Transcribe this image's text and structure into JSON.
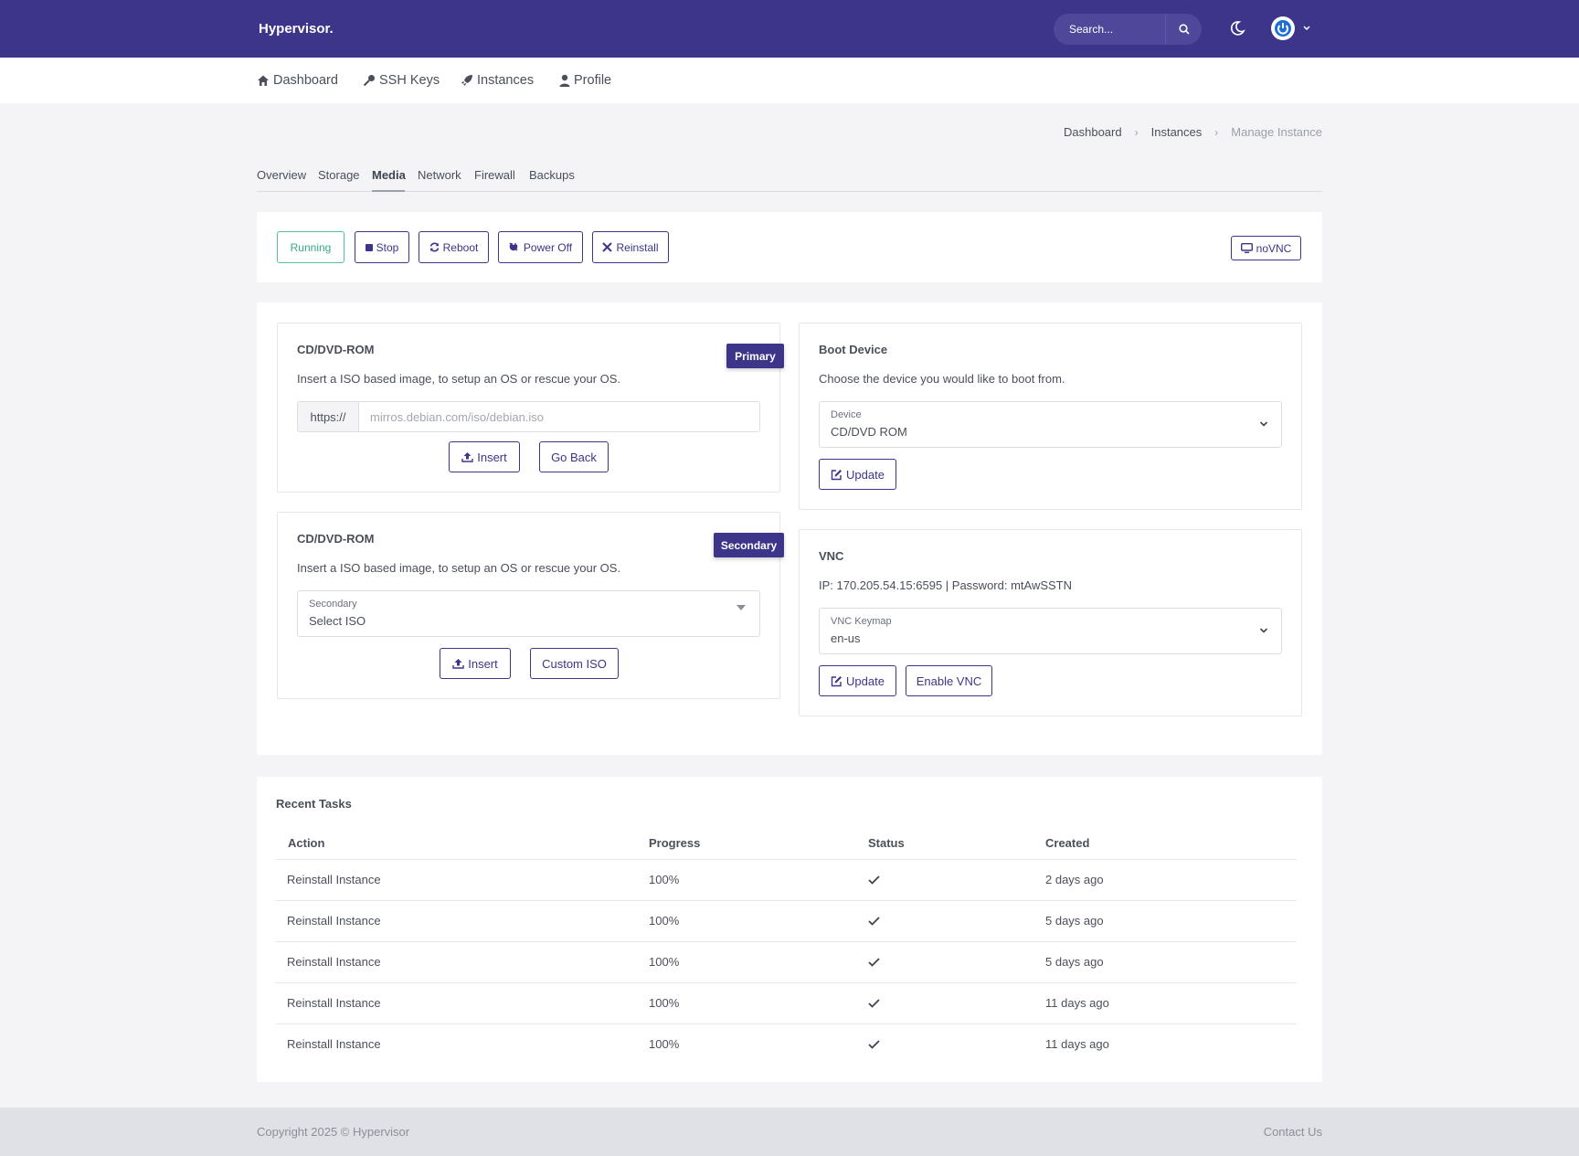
{
  "brand": "Hypervisor.",
  "search": {
    "placeholder": "Search..."
  },
  "nav": [
    {
      "label": "Dashboard",
      "icon": "home-icon"
    },
    {
      "label": "SSH Keys",
      "icon": "key-icon"
    },
    {
      "label": "Instances",
      "icon": "rocket-icon"
    },
    {
      "label": "Profile",
      "icon": "user-icon"
    }
  ],
  "breadcrumb": [
    "Dashboard",
    "Instances",
    "Manage Instance"
  ],
  "tabs": [
    "Overview",
    "Storage",
    "Media",
    "Network",
    "Firewall",
    "Backups"
  ],
  "active_tab": "Media",
  "actions": {
    "status": "Running",
    "stop": "Stop",
    "reboot": "Reboot",
    "poweroff": "Power Off",
    "reinstall": "Reinstall",
    "novnc": "noVNC"
  },
  "primary_cd": {
    "title": "CD/DVD-ROM",
    "badge": "Primary",
    "desc": "Insert a ISO based image, to setup an OS or rescue your OS.",
    "prefix": "https://",
    "placeholder": "mirros.debian.com/iso/debian.iso",
    "insert": "Insert",
    "back": "Go Back"
  },
  "secondary_cd": {
    "title": "CD/DVD-ROM",
    "badge": "Secondary",
    "desc": "Insert a ISO based image, to setup an OS or rescue your OS.",
    "select_label": "Secondary",
    "select_value": "Select ISO",
    "insert": "Insert",
    "custom": "Custom ISO"
  },
  "boot": {
    "title": "Boot Device",
    "desc": "Choose the device you would like to boot from.",
    "select_label": "Device",
    "select_value": "CD/DVD ROM",
    "update": "Update"
  },
  "vnc": {
    "title": "VNC",
    "info": "IP: 170.205.54.15:6595 | Password: mtAwSSTN",
    "select_label": "VNC Keymap",
    "select_value": "en-us",
    "update": "Update",
    "enable": "Enable VNC"
  },
  "tasks": {
    "title": "Recent Tasks",
    "headers": [
      "Action",
      "Progress",
      "Status",
      "Created"
    ],
    "rows": [
      {
        "action": "Reinstall Instance",
        "progress": "100%",
        "status": "check-icon",
        "created": "2 days ago"
      },
      {
        "action": "Reinstall Instance",
        "progress": "100%",
        "status": "check-icon",
        "created": "5 days ago"
      },
      {
        "action": "Reinstall Instance",
        "progress": "100%",
        "status": "check-icon",
        "created": "5 days ago"
      },
      {
        "action": "Reinstall Instance",
        "progress": "100%",
        "status": "check-icon",
        "created": "11 days ago"
      },
      {
        "action": "Reinstall Instance",
        "progress": "100%",
        "status": "check-icon",
        "created": "11 days ago"
      }
    ]
  },
  "footer": {
    "copyright": "Copyright 2025 © Hypervisor",
    "contact": "Contact Us"
  },
  "colors": {
    "brand": "#3c358a",
    "running": "#38a889",
    "background": "#f4f4f6"
  }
}
